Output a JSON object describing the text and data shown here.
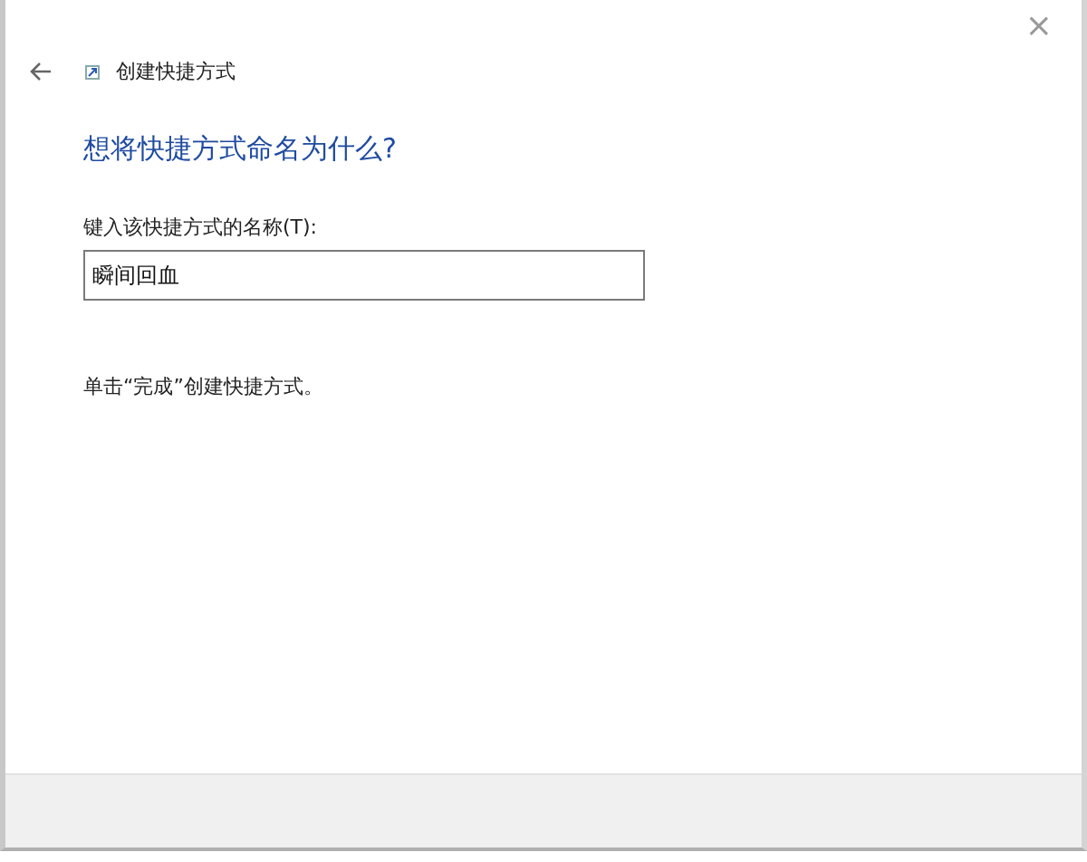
{
  "window": {
    "title": "创建快捷方式",
    "close": "×"
  },
  "heading": "想将快捷方式命名为什么?",
  "name_field": {
    "label": "键入该快捷方式的名称(T):",
    "value": "瞬间回血"
  },
  "hint": "单击“完成”创建快捷方式。"
}
